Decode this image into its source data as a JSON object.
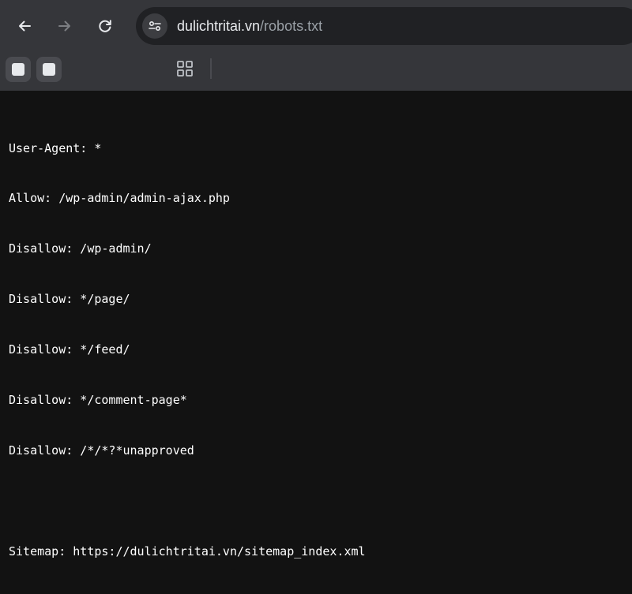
{
  "browser": {
    "url_host": "dulichtritai.vn",
    "url_path": "/robots.txt",
    "icons": {
      "back": "arrow-left-icon",
      "forward": "arrow-right-icon",
      "reload": "reload-icon",
      "site_info": "tune-icon",
      "apps": "apps-grid-icon"
    },
    "colors": {
      "toolbar_bg": "#35363a",
      "omnibox_bg": "#202124",
      "page_bg": "#121212",
      "text": "#ffffff"
    }
  },
  "page": {
    "lines": [
      "User-Agent: *",
      "Allow: /wp-admin/admin-ajax.php",
      "Disallow: /wp-admin/",
      "Disallow: */page/",
      "Disallow: */feed/",
      "Disallow: */comment-page*",
      "Disallow: /*/*?*unapproved",
      "",
      "Sitemap: https://dulichtritai.vn/sitemap_index.xml"
    ]
  }
}
